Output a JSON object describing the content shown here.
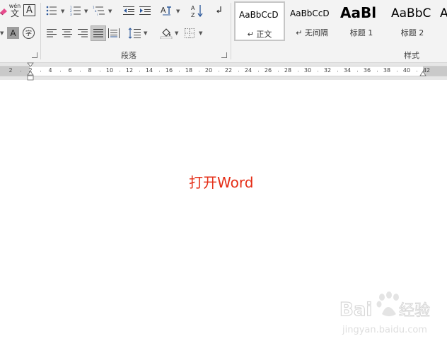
{
  "ribbon": {
    "paragraph_group_label": "段落",
    "styles_group_label": "样式",
    "font_tools": {
      "pinyin_guide_label": "wén",
      "pinyin_guide_char": "文",
      "char_border_glyph": "A",
      "char_shading_glyph": "A",
      "enclose_char_glyph": "字"
    },
    "sort_glyph": "A↓Z"
  },
  "styles": [
    {
      "preview": "AaBbCcD",
      "name": "↵ 正文",
      "selected": true
    },
    {
      "preview": "AaBbCcD",
      "name": "↵ 无间隔",
      "selected": false
    },
    {
      "preview": "AaBl",
      "name": "标题 1",
      "selected": false
    },
    {
      "preview": "AaBbC",
      "name": "标题 2",
      "selected": false
    },
    {
      "preview": "A",
      "name": "",
      "selected": false
    }
  ],
  "ruler": {
    "ticks": [
      "2",
      "2",
      "4",
      "6",
      "8",
      "10",
      "12",
      "14",
      "16",
      "18",
      "20",
      "22",
      "24",
      "26",
      "28",
      "30",
      "32",
      "34",
      "36",
      "38",
      "40",
      "42"
    ]
  },
  "document": {
    "text": "打开Word"
  },
  "watermark": {
    "brand": "Bai 经验",
    "url": "jingyan.baidu.com"
  },
  "colors": {
    "doc_text": "#e52d16",
    "ribbon_bg": "#f3f3f3",
    "selected_tool": "#c8c8c8"
  }
}
